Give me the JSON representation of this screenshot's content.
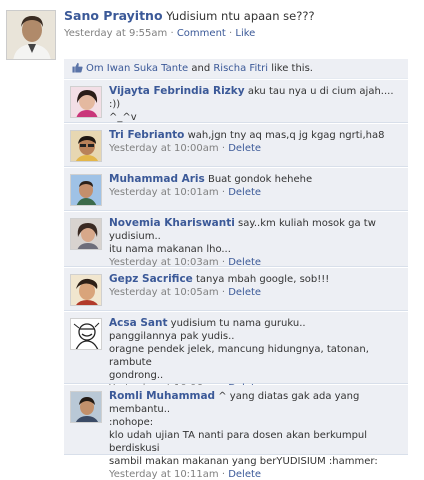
{
  "post": {
    "author": "Sano Prayitno",
    "text": "Yudisium ntu apaan se???",
    "time": "Yesterday at 9:55am",
    "sep": " · ",
    "comment_link": "Comment",
    "like_link": "Like"
  },
  "likes": {
    "person1": "Om Iwan Suka Tante",
    "and": " and ",
    "person2": "Rischa Fitri",
    "suffix": " like this."
  },
  "comments": [
    {
      "author": "Vijayta Febrindia Rizky",
      "lines": [
        "aku tau nya u di cium ajah.... :))",
        "^_^v"
      ],
      "time": "Yesterday at 10:00am",
      "delete": "Delete",
      "h": 43
    },
    {
      "author": "Tri Febrianto",
      "lines": [
        "wah,jgn tny aq mas,q jg kgag ngrti,ha8"
      ],
      "time": "Yesterday at 10:00am",
      "delete": "Delete",
      "h": 43
    },
    {
      "author": "Muhammad Aris",
      "lines": [
        "Buat gondok hehehe"
      ],
      "time": "Yesterday at 10:01am",
      "delete": "Delete",
      "h": 43
    },
    {
      "author": "Novemia Khariswanti",
      "lines": [
        "say..km kuliah mosok ga tw",
        "yudisium..",
        "itu nama makanan lho..."
      ],
      "time": "Yesterday at 10:03am",
      "delete": "Delete",
      "h": 55
    },
    {
      "author": "Gepz Sacrifice",
      "lines": [
        "tanya mbah google, sob!!!"
      ],
      "time": "Yesterday at 10:05am",
      "delete": "Delete",
      "h": 43
    },
    {
      "author": "Acsa Sant",
      "lines": [
        "yudisium tu nama guruku..",
        "panggilannya pak yudis..",
        "oragne pendek jelek, mancung hidungnya, tatonan, rambute",
        "gondrong.."
      ],
      "time": "Yesterday at 10:06am",
      "delete": "Delete",
      "h": 72
    },
    {
      "author": "Romli Muhammad",
      "lines": [
        "^ yang diatas gak ada yang membantu..",
        ":nohope:",
        "klo udah ujian TA nanti para dosen akan berkumpul berdiskusi",
        "sambil makan makanan yang berYUDISIUM :hammer:"
      ],
      "time": "Yesterday at 10:11am",
      "delete": "Delete",
      "h": 70
    }
  ],
  "colors": {
    "link": "#3b5998",
    "meta": "#808080",
    "comment_bg": "#edeff4"
  }
}
